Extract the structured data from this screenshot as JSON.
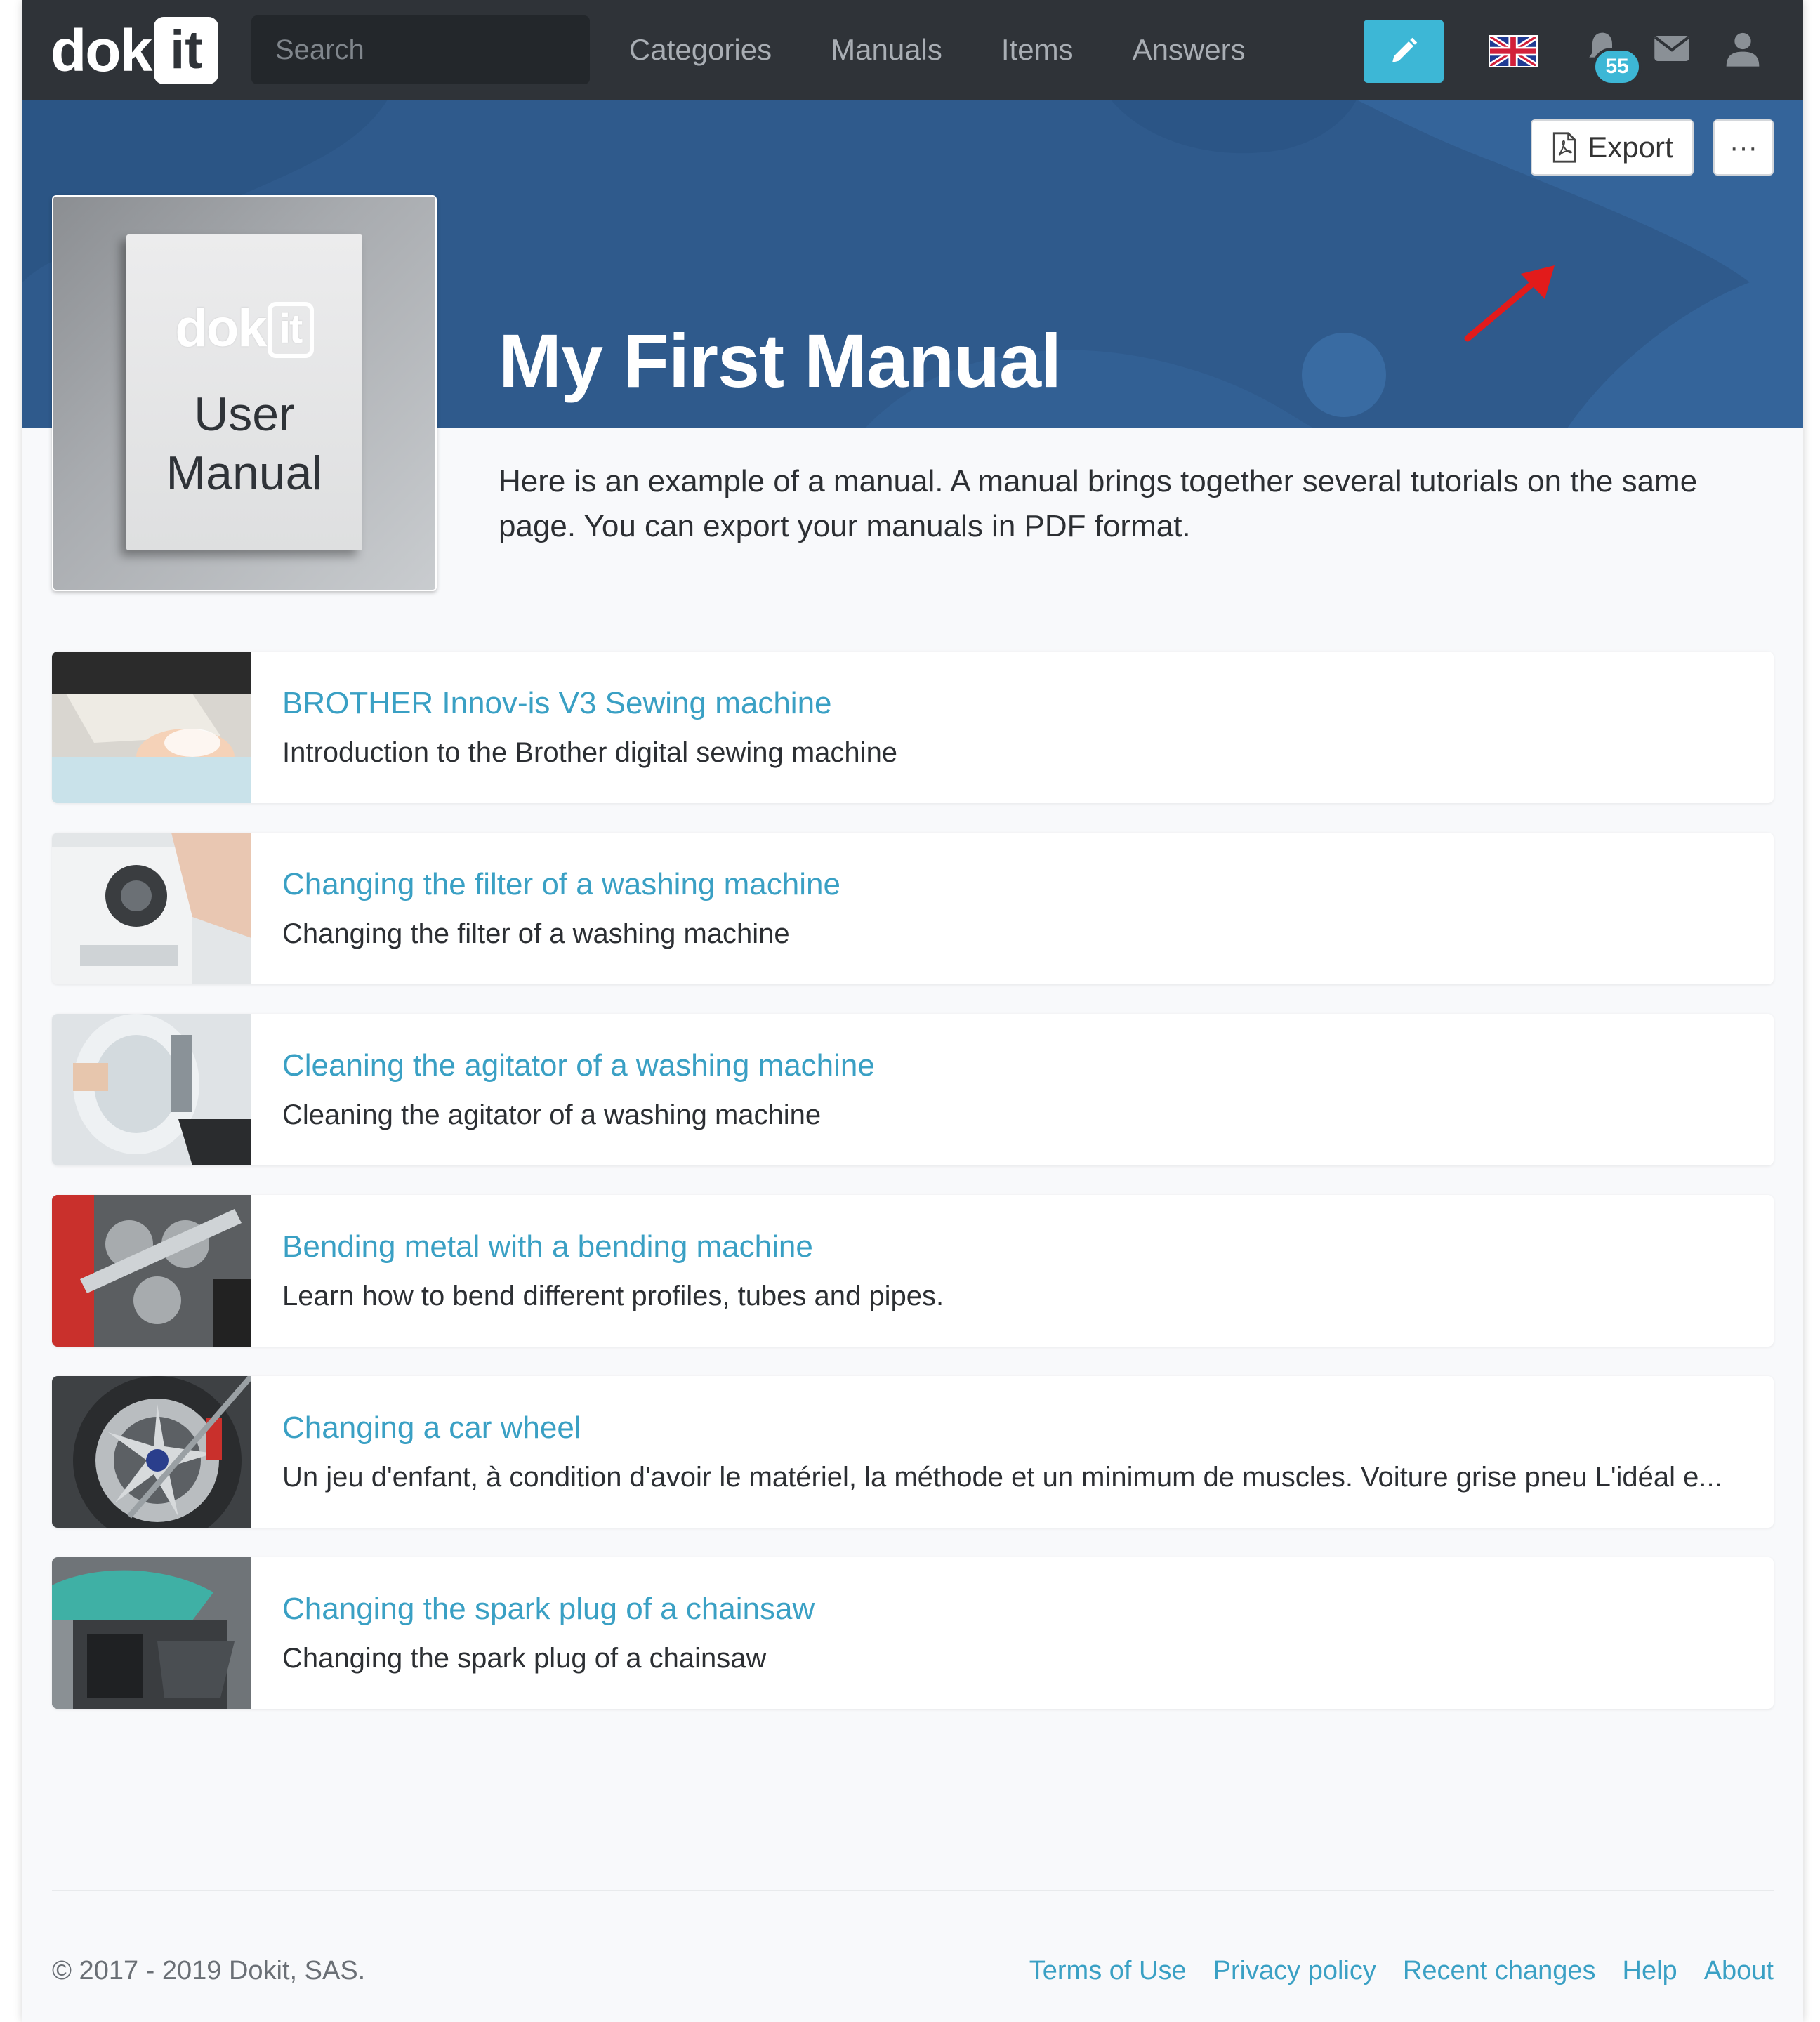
{
  "navbar": {
    "logo_text": "dok",
    "logo_badge": "it",
    "search_placeholder": "Search",
    "links": [
      "Categories",
      "Manuals",
      "Items",
      "Answers"
    ],
    "notification_count": "55",
    "accent_color": "#3db7d6",
    "icons": [
      "search-icon",
      "pencil-icon",
      "uk-flag-icon",
      "bell-icon",
      "envelope-icon",
      "user-icon"
    ]
  },
  "hero": {
    "export_label": "Export",
    "more_label": "···",
    "title": "My First Manual",
    "background_color": "#2f5a8c"
  },
  "cover": {
    "logo_text": "dok",
    "logo_badge": "it",
    "line1": "User",
    "line2": "Manual"
  },
  "description": "Here is an example of a manual. A manual brings together several tutorials on the same page. You can export your manuals in PDF format.",
  "items": [
    {
      "title": "BROTHER Innov-is V3 Sewing machine",
      "description": "Introduction to the Brother digital sewing machine"
    },
    {
      "title": "Changing the filter of a washing machine",
      "description": "Changing the filter of a washing machine"
    },
    {
      "title": "Cleaning the agitator of a washing machine",
      "description": "Cleaning the agitator of a washing machine"
    },
    {
      "title": "Bending metal with a bending machine",
      "description": "Learn how to bend different profiles, tubes and pipes."
    },
    {
      "title": "Changing a car wheel",
      "description": "Un jeu d'enfant, à condition d'avoir le matériel, la méthode et un minimum de muscles. Voiture grise pneu L'idéal e..."
    },
    {
      "title": "Changing the spark plug of a chainsaw",
      "description": "Changing the spark plug of a chainsaw"
    }
  ],
  "footer": {
    "copyright": "© 2017 - 2019 Dokit, SAS.",
    "links": [
      "Terms of Use",
      "Privacy policy",
      "Recent changes",
      "Help",
      "About"
    ]
  }
}
